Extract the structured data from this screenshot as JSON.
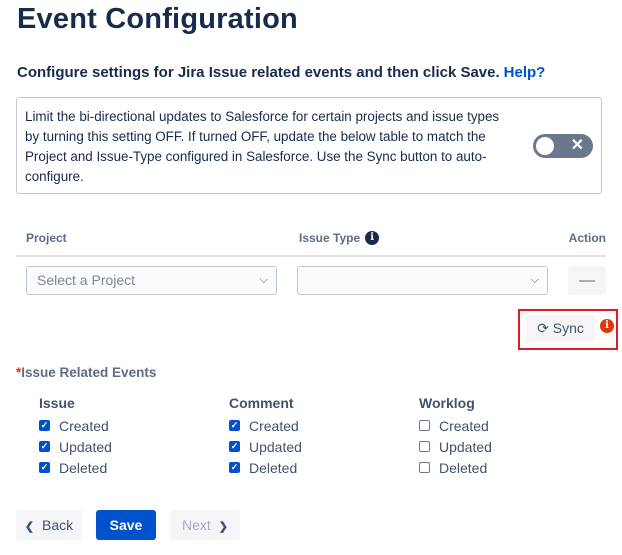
{
  "page": {
    "title": "Event Configuration",
    "subtitle": "Configure settings for Jira Issue related events and then click Save.",
    "help_link": "Help?"
  },
  "info_box": {
    "text": "Limit the bi-directional updates to Salesforce for certain projects and issue types by turning this setting OFF. If turned OFF, update the below table to match the Project and Issue-Type configured in Salesforce. Use the Sync button to auto-configure.",
    "toggle_state": "off",
    "toggle_icon": "close-icon"
  },
  "table": {
    "headers": {
      "project": "Project",
      "issue_type": "Issue Type",
      "action": "Action"
    },
    "row": {
      "project_placeholder": "Select a Project",
      "issue_type_value": "",
      "action_icon": "minus-icon"
    }
  },
  "sync": {
    "label": "Sync",
    "icon": "sync-icon",
    "warning_icon": "info-icon"
  },
  "events": {
    "required_mark": "*",
    "label": "Issue Related Events",
    "columns": [
      {
        "title": "Issue",
        "items": [
          {
            "label": "Created",
            "checked": true
          },
          {
            "label": "Updated",
            "checked": true
          },
          {
            "label": "Deleted",
            "checked": true
          }
        ]
      },
      {
        "title": "Comment",
        "items": [
          {
            "label": "Created",
            "checked": true
          },
          {
            "label": "Updated",
            "checked": true
          },
          {
            "label": "Deleted",
            "checked": true
          }
        ]
      },
      {
        "title": "Worklog",
        "items": [
          {
            "label": "Created",
            "checked": false
          },
          {
            "label": "Updated",
            "checked": false
          },
          {
            "label": "Deleted",
            "checked": false
          }
        ]
      }
    ]
  },
  "footer": {
    "back_label": "Back",
    "save_label": "Save",
    "next_label": "Next"
  },
  "colors": {
    "primary": "#0052cc",
    "highlight": "#e01b24",
    "warning": "#de350b"
  }
}
